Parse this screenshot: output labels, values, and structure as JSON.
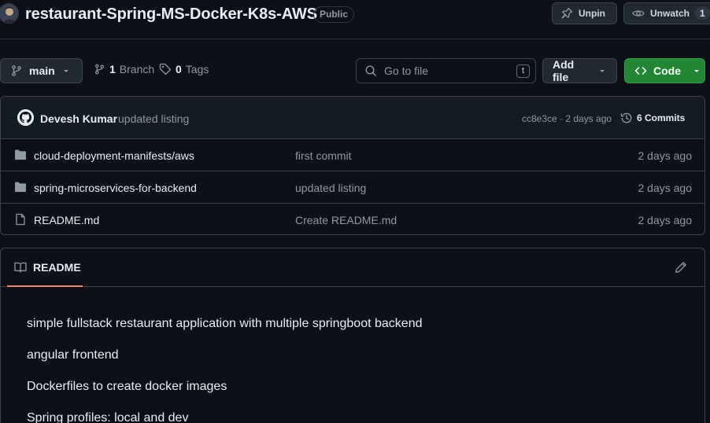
{
  "repo": {
    "name": "restaurant-Spring-MS-Docker-K8s-AWS",
    "visibility": "Public",
    "avatar_icon": "user-avatar"
  },
  "header_actions": {
    "unpin_label": "Unpin",
    "unwatch_label": "Unwatch",
    "watch_count": "1"
  },
  "toolbar": {
    "branch": "main",
    "branches_count": "1",
    "branches_label": "Branch",
    "tags_count": "0",
    "tags_label": "Tags",
    "search_placeholder": "Go to file",
    "search_shortcut": "t",
    "add_file_label": "Add file",
    "code_label": "Code"
  },
  "latest_commit": {
    "author": "Devesh Kumar",
    "message": "updated listing",
    "meta": "cc8e3ce · 2 days ago",
    "commits_label": "6 Commits"
  },
  "files": [
    {
      "name": "cloud-deployment-manifests/aws",
      "type": "folder",
      "icon": "folder-icon",
      "commit": "first commit",
      "date": "2 days ago"
    },
    {
      "name": "spring-microservices-for-backend",
      "type": "folder",
      "icon": "folder-icon",
      "commit": "updated listing",
      "date": "2 days ago"
    },
    {
      "name": "README.md",
      "type": "file",
      "icon": "file-icon",
      "commit": "Create README.md",
      "date": "2 days ago"
    }
  ],
  "readme": {
    "tab_label": "README",
    "lines": [
      "simple fullstack restaurant application with multiple springboot backend",
      "angular frontend",
      "Dockerfiles to create docker images",
      "Spring profiles: local and dev"
    ]
  },
  "colors": {
    "background": "#0d1117",
    "border": "#3d444d",
    "code_button": "#238636",
    "active_tab_underline": "#f78166"
  }
}
